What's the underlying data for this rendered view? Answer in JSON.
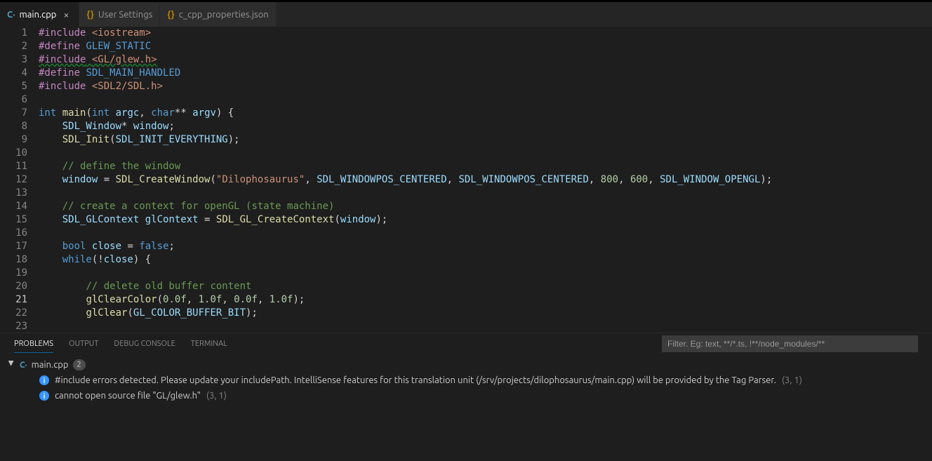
{
  "tabs": [
    {
      "label": "main.cpp",
      "icon": "cpp",
      "active": true,
      "dirty": false,
      "closeable": true
    },
    {
      "label": "User Settings",
      "icon": "json",
      "active": false
    },
    {
      "label": "c_cpp_properties.json",
      "icon": "json",
      "active": false
    }
  ],
  "editor": {
    "filename": "main.cpp",
    "line_count": 23,
    "current_line": 21,
    "tokens": [
      [
        [
          "pp",
          "#include"
        ],
        [
          "text",
          " "
        ],
        [
          "inc",
          "<iostream>"
        ]
      ],
      [
        [
          "pp",
          "#define"
        ],
        [
          "text",
          " "
        ],
        [
          "macro",
          "GLEW_STATIC"
        ]
      ],
      [
        [
          "pp-sq",
          "#include"
        ],
        [
          "text-sq",
          " "
        ],
        [
          "inc-sq",
          "<GL/glew.h>"
        ]
      ],
      [
        [
          "pp",
          "#define"
        ],
        [
          "text",
          " "
        ],
        [
          "macro",
          "SDL_MAIN_HANDLED"
        ]
      ],
      [
        [
          "pp",
          "#include"
        ],
        [
          "text",
          " "
        ],
        [
          "inc",
          "<SDL2/SDL.h>"
        ]
      ],
      [],
      [
        [
          "key",
          "int"
        ],
        [
          "text",
          " "
        ],
        [
          "fun",
          "main"
        ],
        [
          "text",
          "("
        ],
        [
          "key",
          "int"
        ],
        [
          "text",
          " "
        ],
        [
          "id",
          "argc"
        ],
        [
          "text",
          ", "
        ],
        [
          "key",
          "char"
        ],
        [
          "text",
          "** "
        ],
        [
          "id",
          "argv"
        ],
        [
          "text",
          ") {"
        ]
      ],
      [
        [
          "text",
          "    "
        ],
        [
          "id",
          "SDL_Window"
        ],
        [
          "text",
          "* "
        ],
        [
          "id",
          "window"
        ],
        [
          "text",
          ";"
        ]
      ],
      [
        [
          "text",
          "    "
        ],
        [
          "fun",
          "SDL_Init"
        ],
        [
          "text",
          "("
        ],
        [
          "id",
          "SDL_INIT_EVERYTHING"
        ],
        [
          "text",
          ");"
        ]
      ],
      [],
      [
        [
          "text",
          "    "
        ],
        [
          "com",
          "// define the window"
        ]
      ],
      [
        [
          "text",
          "    "
        ],
        [
          "id",
          "window"
        ],
        [
          "text",
          " = "
        ],
        [
          "fun",
          "SDL_CreateWindow"
        ],
        [
          "text",
          "("
        ],
        [
          "str",
          "\"Dilophosaurus\""
        ],
        [
          "text",
          ", "
        ],
        [
          "id",
          "SDL_WINDOWPOS_CENTERED"
        ],
        [
          "text",
          ", "
        ],
        [
          "id",
          "SDL_WINDOWPOS_CENTERED"
        ],
        [
          "text",
          ", "
        ],
        [
          "num",
          "800"
        ],
        [
          "text",
          ", "
        ],
        [
          "num",
          "600"
        ],
        [
          "text",
          ", "
        ],
        [
          "id",
          "SDL_WINDOW_OPENGL"
        ],
        [
          "text",
          ");"
        ]
      ],
      [],
      [
        [
          "text",
          "    "
        ],
        [
          "com",
          "// create a context for openGL (state machine)"
        ]
      ],
      [
        [
          "text",
          "    "
        ],
        [
          "id",
          "SDL_GLContext"
        ],
        [
          "text",
          " "
        ],
        [
          "id",
          "glContext"
        ],
        [
          "text",
          " = "
        ],
        [
          "fun",
          "SDL_GL_CreateContext"
        ],
        [
          "text",
          "("
        ],
        [
          "id",
          "window"
        ],
        [
          "text",
          ");"
        ]
      ],
      [],
      [
        [
          "text",
          "    "
        ],
        [
          "key",
          "bool"
        ],
        [
          "text",
          " "
        ],
        [
          "id",
          "close"
        ],
        [
          "text",
          " = "
        ],
        [
          "key",
          "false"
        ],
        [
          "text",
          ";"
        ]
      ],
      [
        [
          "text",
          "    "
        ],
        [
          "key",
          "while"
        ],
        [
          "text",
          "(!"
        ],
        [
          "id",
          "close"
        ],
        [
          "text",
          ") {"
        ]
      ],
      [
        [
          "text",
          "        "
        ]
      ],
      [
        [
          "text",
          "        "
        ],
        [
          "com",
          "// delete old buffer content"
        ]
      ],
      [
        [
          "text",
          "        "
        ],
        [
          "fun",
          "glClearColor"
        ],
        [
          "text",
          "("
        ],
        [
          "num",
          "0.0f"
        ],
        [
          "text",
          ", "
        ],
        [
          "num",
          "1.0f"
        ],
        [
          "text",
          ", "
        ],
        [
          "num",
          "0.0f"
        ],
        [
          "text",
          ", "
        ],
        [
          "num",
          "1.0f"
        ],
        [
          "text",
          ");"
        ]
      ],
      [
        [
          "text",
          "        "
        ],
        [
          "fun",
          "glClear"
        ],
        [
          "text",
          "("
        ],
        [
          "id",
          "GL_COLOR_BUFFER_BIT"
        ],
        [
          "text",
          ");"
        ]
      ],
      []
    ]
  },
  "panel": {
    "tabs": [
      "PROBLEMS",
      "OUTPUT",
      "DEBUG CONSOLE",
      "TERMINAL"
    ],
    "active_tab": "PROBLEMS",
    "filter_placeholder": "Filter. Eg: text, **/*.ts, !**/node_modules/**",
    "file": {
      "name": "main.cpp",
      "count": 2
    },
    "problems": [
      {
        "sev": "info",
        "msg": "#include errors detected. Please update your includePath. IntelliSense features for this translation unit (/srv/projects/dilophosaurus/main.cpp) will be provided by the Tag Parser.",
        "loc": "(3, 1)"
      },
      {
        "sev": "info",
        "msg": "cannot open source file \"GL/glew.h\"",
        "loc": "(3, 1)"
      }
    ]
  }
}
